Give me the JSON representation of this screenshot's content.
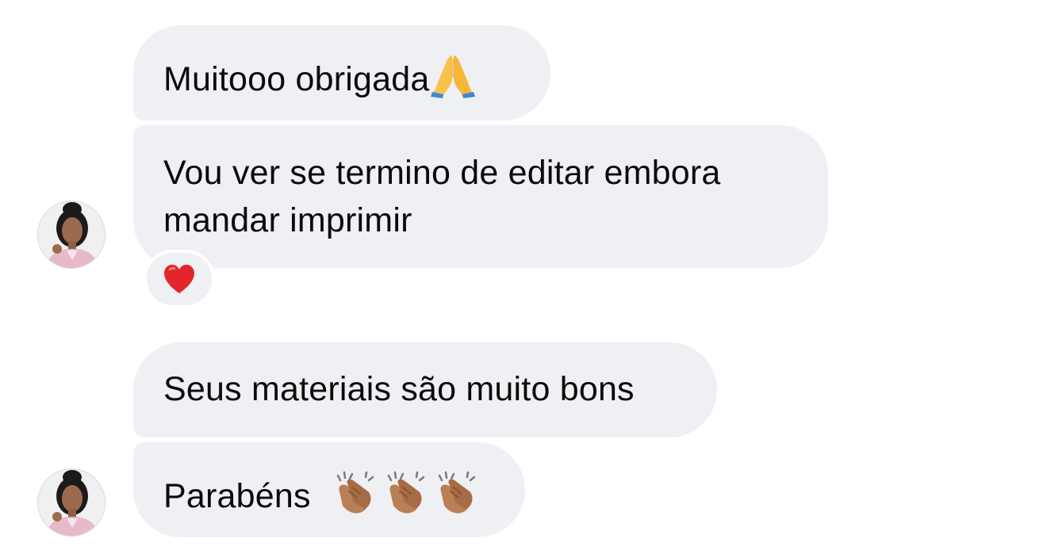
{
  "thread": {
    "messages": [
      {
        "text": "Muitooo obrigada",
        "emoji": "folded-hands"
      },
      {
        "lines": [
          "Vou ver se termino de editar embora",
          "mandar imprimir"
        ],
        "reaction": "red-heart"
      },
      {
        "text": "Seus materiais são muito bons"
      },
      {
        "text": "Parabéns",
        "emoji": [
          "clapping-hands",
          "clapping-hands",
          "clapping-hands"
        ]
      }
    ]
  },
  "colors": {
    "bubble": "#eef0f3",
    "text": "#0b0b0b",
    "background": "#ffffff",
    "heart": "#e3262b"
  }
}
